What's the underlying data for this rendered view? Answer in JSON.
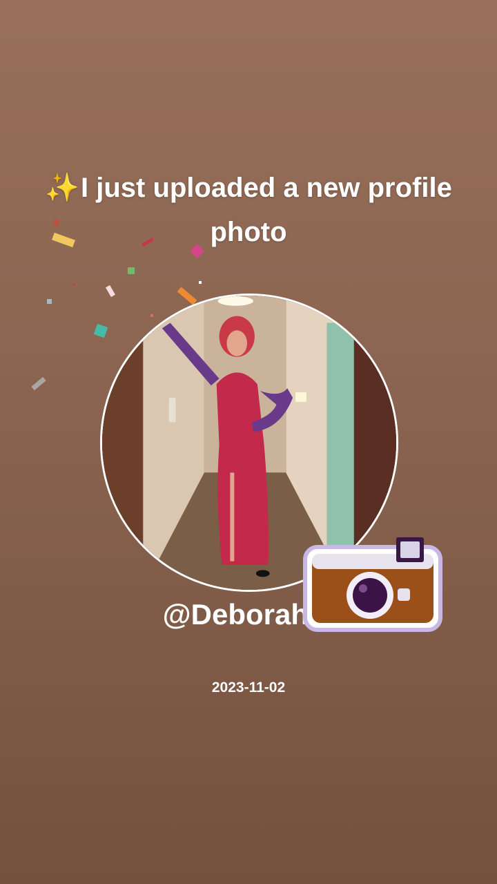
{
  "headline": {
    "sparkle_icon": "✨",
    "text": "I just uploaded a new profile photo"
  },
  "profile": {
    "username": "@Deborah T",
    "date": "2023-11-02",
    "photo_icon": "profile-photo"
  },
  "decor": {
    "camera_icon": "camera-icon",
    "confetti_icon": "confetti"
  },
  "colors": {
    "background_top": "#98705b",
    "background_bottom": "#74513e",
    "text": "#ffffff",
    "sparkle": "#ffd84a"
  }
}
